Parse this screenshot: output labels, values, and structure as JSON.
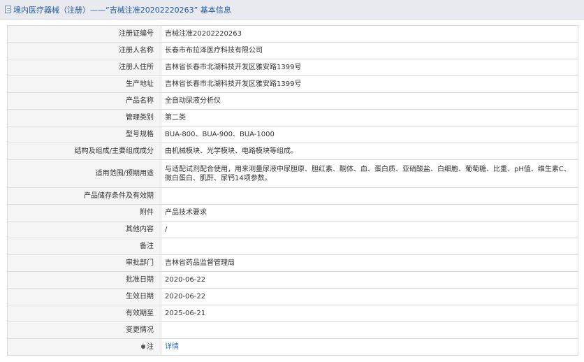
{
  "header": {
    "title": "境内医疗器械（注册）——“吉械注准20202220263” 基本信息"
  },
  "rows": [
    {
      "label": "注册证编号",
      "value": "吉械注准20202220263"
    },
    {
      "label": "注册人名称",
      "value": "长春市布拉泽医疗科技有限公司"
    },
    {
      "label": "注册人住所",
      "value": "吉林省长春市北湖科技开发区雅安路1399号"
    },
    {
      "label": "生产地址",
      "value": "吉林省长春市北湖科技开发区雅安路1399号"
    },
    {
      "label": "产品名称",
      "value": "全自动尿液分析仪"
    },
    {
      "label": "管理类别",
      "value": "第二类"
    },
    {
      "label": "型号规格",
      "value": "BUA-800、BUA-900、BUA-1000"
    },
    {
      "label": "结构及组成/主要组成成分",
      "value": "由机械模块、光学模块、电路模块等组成。"
    },
    {
      "label": "适用范围/预期用途",
      "value": "与适配试剂配合使用，用来测量尿液中尿胆原、胆红素、酮体、血、蛋白质、亚硝酸盐、白细胞、葡萄糖、比重、pH值、维生素C、微白蛋白、肌酐、尿钙14项参数。"
    },
    {
      "label": "产品储存条件及有效期",
      "value": ""
    },
    {
      "label": "附件",
      "value": "产品技术要求"
    },
    {
      "label": "其他内容",
      "value": "/"
    },
    {
      "label": "备注",
      "value": ""
    },
    {
      "label": "审批部门",
      "value": "吉林省药品监督管理局"
    },
    {
      "label": "批准日期",
      "value": "2020-06-22"
    },
    {
      "label": "生效日期",
      "value": "2020-06-22"
    },
    {
      "label": "有效期至",
      "value": "2025-06-21"
    },
    {
      "label": "变更情况",
      "value": ""
    }
  ],
  "note_row": {
    "label": "注",
    "link_text": "详情"
  }
}
